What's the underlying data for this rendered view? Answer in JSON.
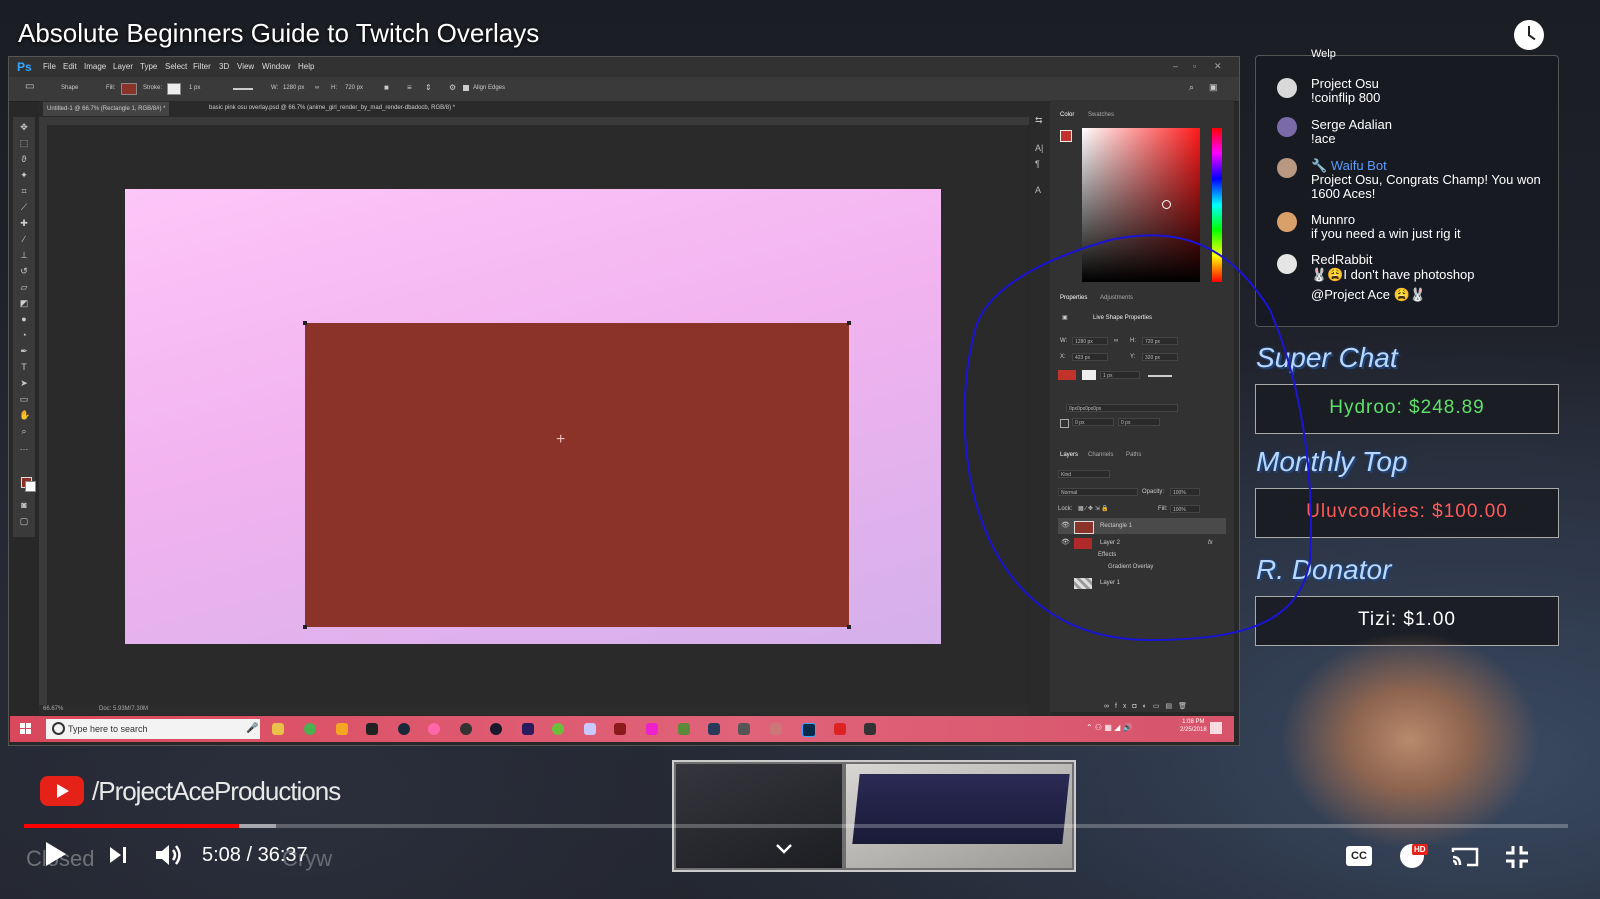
{
  "video": {
    "title": "Absolute Beginners Guide to Twitch Overlays",
    "channel": "/ProjectAceProductions",
    "time": "5:08 / 36:37",
    "progress_fraction": 0.139,
    "buffered_fraction": 0.163,
    "cc_label": "CC",
    "hd_badge": "HD"
  },
  "photoshop": {
    "logo": "Ps",
    "menu": [
      "File",
      "Edit",
      "Image",
      "Layer",
      "Type",
      "Select",
      "Filter",
      "3D",
      "View",
      "Window",
      "Help"
    ],
    "options": {
      "mode": "Shape",
      "fill_label": "Fill:",
      "stroke_label": "Stroke:",
      "stroke_width": "1 px",
      "w_label": "W:",
      "w_value": "1280 px",
      "h_label": "H:",
      "h_value": "720 px",
      "align_edges": "Align Edges"
    },
    "tabs": [
      "Untitled-1 @ 66.7% (Rectangle 1, RGB/8#) *",
      "basic pink osu overlay.psd @ 66.7% (anime_girl_render_by_mad_render-dbadocb, RGB/8) *"
    ],
    "status": {
      "zoom": "66.67%",
      "doc": "Doc: 5.93M/7.30M"
    },
    "panels": {
      "color_tab": "Color",
      "swatches_tab": "Swatches",
      "properties_tab": "Properties",
      "adjustments_tab": "Adjustments",
      "live_shape": "Live Shape Properties",
      "w": "1280 px",
      "h": "720 px",
      "x": "423 px",
      "y": "320 px",
      "stroke_w": "1 px",
      "corner": "0px0px0px0px",
      "c1": "0 px",
      "c2": "0 px",
      "layers_tab": "Layers",
      "channels_tab": "Channels",
      "paths_tab": "Paths",
      "kind": "Kind",
      "blend": "Normal",
      "opacity_label": "Opacity:",
      "opacity": "100%",
      "lock_label": "Lock:",
      "fill_label": "Fill:",
      "fill": "100%",
      "layers": [
        "Rectangle 1",
        "Layer 2",
        "Effects",
        "Gradient Overlay",
        "Layer 1"
      ],
      "fx": "fx"
    }
  },
  "taskbar": {
    "search_placeholder": "Type here to search",
    "time": "1:08 PM",
    "date": "2/25/2018"
  },
  "chat": [
    {
      "user": "Welp",
      "text": ""
    },
    {
      "user": "Project Osu",
      "text": "!coinflip 800",
      "avatar": "#d9d9d9"
    },
    {
      "user": "Serge Adalian",
      "text": "!ace",
      "avatar": "#7a6aa8"
    },
    {
      "user": "Waifu Bot",
      "text": "Project Osu, Congrats Champ! You won 1600 Aces!",
      "avatar": "#b89880",
      "name_color": "#5a9cff"
    },
    {
      "user": "Munnro",
      "text": "if you need a win just rig it",
      "avatar": "#d9a06a"
    },
    {
      "user": "RedRabbit",
      "text": "I don't have photoshop",
      "text2": "@Project Ace",
      "avatar": "#e5e5e5"
    }
  ],
  "alerts": {
    "super_chat": {
      "title": "Super Chat",
      "value": "Hydroo: $248.89",
      "color": "#5fe06a"
    },
    "monthly_top": {
      "title": "Monthly Top",
      "value": "Uluvcookies: $100.00",
      "color": "#ff5a5a"
    },
    "recent_donator": {
      "title": "R. Donator",
      "value": "Tizi: $1.00",
      "color": "#ffffff"
    }
  },
  "ghost_text": {
    "left": "Closed",
    "right": "Cryw"
  },
  "colors": {
    "rectangle": "#8b3229",
    "accent_red": "#e62117",
    "taskbar": "#dd5670",
    "annotation": "#1a14d6"
  },
  "icons": [
    "clock-icon",
    "youtube-logo-icon",
    "play-icon",
    "next-icon",
    "volume-icon",
    "cc-icon",
    "settings-gear-icon",
    "cast-icon",
    "fullscreen-exit-icon",
    "chevron-down-icon",
    "windows-start-icon",
    "search-icon",
    "microphone-icon"
  ]
}
